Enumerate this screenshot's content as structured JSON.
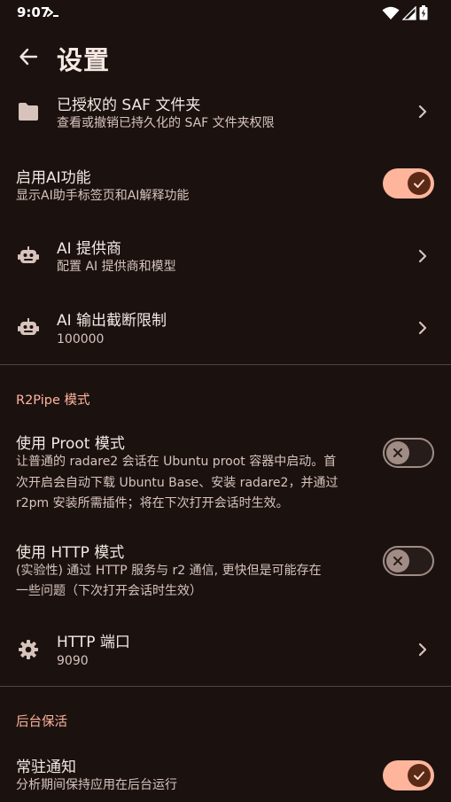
{
  "status_bar": {
    "time": "9:07"
  },
  "app_bar": {
    "title": "设置"
  },
  "rows": {
    "saf": {
      "title": "已授权的 SAF 文件夹",
      "subtitle": "查看或撤销已持久化的 SAF 文件夹权限",
      "icon": "folder-icon"
    },
    "ai_enable": {
      "title": "启用AI功能",
      "subtitle": "显示AI助手标签页和AI解释功能",
      "enabled": true
    },
    "ai_provider": {
      "title": "AI 提供商",
      "subtitle": "配置 AI 提供商和模型",
      "icon": "robot-icon"
    },
    "ai_output_limit": {
      "title": "AI 输出截断限制",
      "subtitle": "100000",
      "icon": "robot-icon"
    },
    "proot": {
      "title": "使用 Proot 模式",
      "subtitle_lines": [
        "让普通的 radare2 会话在 Ubuntu proot 容器中启动。首",
        "次开启会自动下载 Ubuntu Base、安装 radare2，并通过",
        "r2pm 安装所需插件；将在下次打开会话时生效。"
      ],
      "enabled": false
    },
    "http_mode": {
      "title": "使用 HTTP 模式",
      "subtitle_lines": [
        "(实验性) 通过 HTTP 服务与 r2 通信, 更快但是可能存在",
        "一些问题（下次打开会话时生效）"
      ],
      "enabled": false
    },
    "http_port": {
      "title": "HTTP 端口",
      "subtitle": "9090",
      "icon": "gear-icon"
    },
    "persistent_notification": {
      "title": "常驻通知",
      "subtitle": "分析期间保持应用在后台运行",
      "enabled": true
    }
  },
  "sections": {
    "r2pipe": "R2Pipe 模式",
    "background": "后台保活"
  },
  "colors": {
    "background": "#1b1210",
    "accent": "#ffb59c",
    "switch_on_knob": "#5b2a17",
    "switch_off_outline": "#a08c85"
  }
}
